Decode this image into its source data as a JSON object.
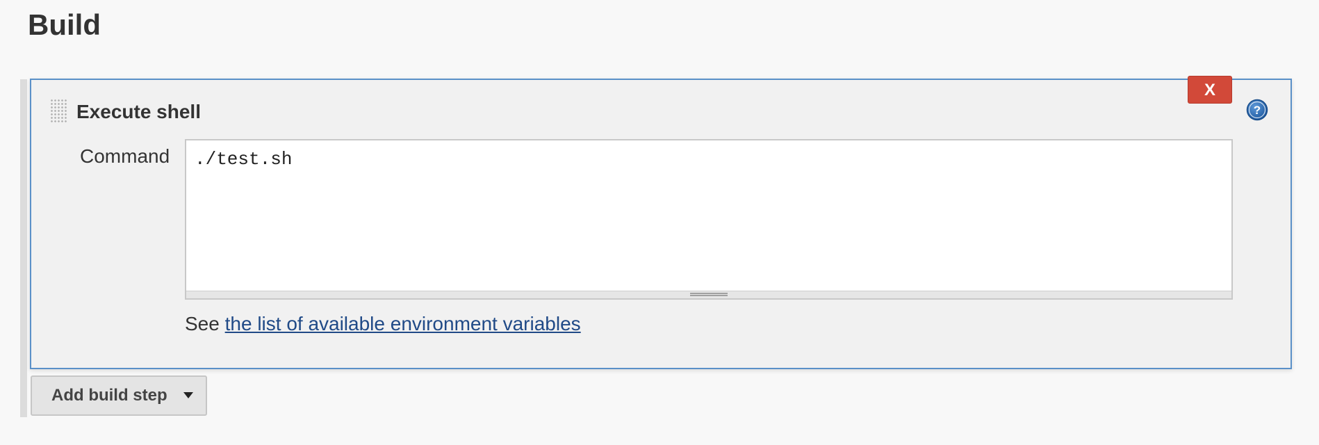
{
  "section": {
    "title": "Build"
  },
  "step": {
    "title": "Execute shell",
    "delete_label": "X",
    "help_icon": "question-circle-icon",
    "command_label": "Command",
    "command_value": "./test.sh",
    "env_prefix": "See ",
    "env_link": "the list of available environment variables"
  },
  "actions": {
    "add_build_step_label": "Add build step"
  },
  "colors": {
    "step_border": "#5a90c8",
    "delete_button": "#d24939",
    "link": "#204a87",
    "help_icon": "#2d6bb5"
  }
}
